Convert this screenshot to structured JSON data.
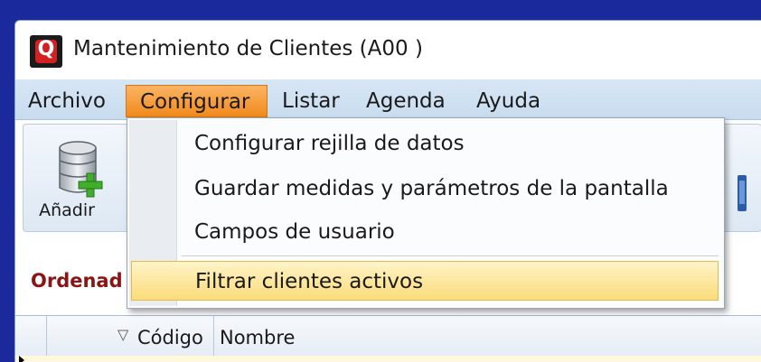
{
  "window": {
    "title": "Mantenimiento de Clientes (A00 )",
    "app_icon_letter": "Q"
  },
  "menubar": {
    "items": [
      {
        "label": "Archivo"
      },
      {
        "label": "Configurar",
        "active": true
      },
      {
        "label": "Listar"
      },
      {
        "label": "Agenda"
      },
      {
        "label": "Ayuda"
      }
    ]
  },
  "toolbar": {
    "add_label": "Añadir",
    "add_icon": "database-add-icon"
  },
  "order": {
    "label": "Ordenad"
  },
  "grid": {
    "columns": [
      {
        "label": "Código",
        "sorted": "descending"
      },
      {
        "label": "Nombre"
      }
    ]
  },
  "dropdown": {
    "items": [
      {
        "label": "Configurar rejilla de datos"
      },
      {
        "label": "Guardar medidas y parámetros de la pantalla"
      },
      {
        "label": "Campos de usuario"
      },
      {
        "label": "Filtrar clientes activos",
        "highlighted": true
      }
    ]
  },
  "colors": {
    "desktop": "#1a2a9c",
    "menu_active": "#f08a1c",
    "highlight": "#fbdc7a",
    "order_label": "#8b1414"
  }
}
